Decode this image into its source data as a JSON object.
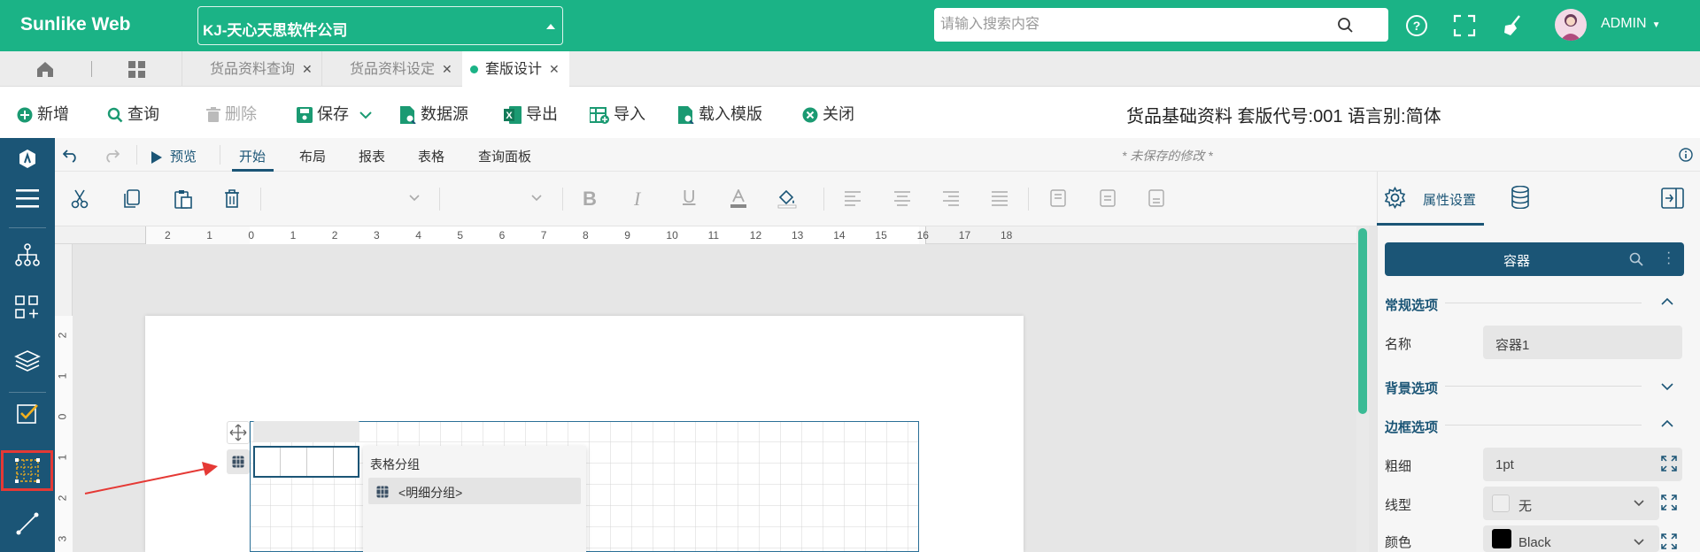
{
  "header": {
    "brand": "Sunlike Web",
    "company": "KJ-天心天思软件公司",
    "search_placeholder": "请输入搜索内容",
    "user": "ADMIN"
  },
  "tabs": [
    {
      "label": ""
    },
    {
      "label": "货品资料查询"
    },
    {
      "label": "货品资料设定"
    },
    {
      "label": "套版设计"
    }
  ],
  "toolbar": {
    "new": "新增",
    "query": "查询",
    "delete": "删除",
    "save": "保存",
    "datasource": "数据源",
    "export": "导出",
    "import": "导入",
    "load_template": "载入模版",
    "close": "关闭",
    "title": "货品基础资料  套版代号:001  语言别:简体"
  },
  "design": {
    "preview": "预览",
    "menus": [
      "开始",
      "布局",
      "报表",
      "表格",
      "查询面板"
    ],
    "unsaved": "* 未保存的修改 *"
  },
  "ruler": {
    "h": [
      "2",
      "1",
      "0",
      "1",
      "2",
      "3",
      "4",
      "5",
      "6",
      "7",
      "8",
      "9",
      "10",
      "11",
      "12",
      "13",
      "14",
      "15",
      "16",
      "17",
      "18"
    ],
    "v": [
      "2",
      "1",
      "0",
      "1",
      "2",
      "3"
    ]
  },
  "popup": {
    "title": "表格分组",
    "item": "<明细分组>"
  },
  "panel": {
    "tab_properties": "属性设置",
    "container": "容器",
    "general": "常规选项",
    "name_label": "名称",
    "name_value": "容器1",
    "background": "背景选项",
    "border": "边框选项",
    "width_label": "粗细",
    "width_value": "1pt",
    "linetype_label": "线型",
    "linetype_value": "无",
    "color_label": "颜色",
    "color_value": "Black"
  },
  "colors": {
    "header": "#1bb386",
    "nav": "#1b5576",
    "annotation": "#e53935"
  }
}
